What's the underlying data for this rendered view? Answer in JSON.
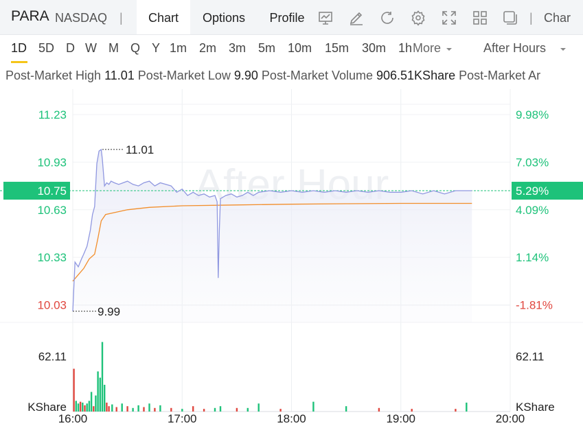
{
  "header": {
    "ticker": "PARA",
    "exchange": "NASDAQ",
    "separator": "|",
    "tabs": [
      "Chart",
      "Options",
      "Profile"
    ],
    "cut_tab": "Char",
    "icons": [
      "indicator-icon",
      "draw-icon",
      "refresh-icon",
      "settings-icon",
      "fullscreen-icon",
      "layout-icon",
      "window-icon"
    ]
  },
  "periods": {
    "items": [
      "1D",
      "5D",
      "D",
      "W",
      "M",
      "Q",
      "Y",
      "1m",
      "2m",
      "3m",
      "5m",
      "10m",
      "15m",
      "30m",
      "1h"
    ],
    "more": "More",
    "session": "After Hours"
  },
  "stats": {
    "high_label": "Post-Market High",
    "high_value": "11.01",
    "low_label": "Post-Market Low",
    "low_value": "9.90",
    "volume_label": "Post-Market Volume",
    "volume_value": "906.51KShare",
    "cut_label": "Post-Market Ar"
  },
  "chart_data": {
    "type": "line",
    "watermark": "After Hour",
    "x_ticks": [
      "16:00",
      "17:00",
      "18:00",
      "19:00",
      "20:00"
    ],
    "y_ticks": [
      "11.23",
      "10.93",
      "10.63",
      "10.33",
      "10.03"
    ],
    "y_tick_values": [
      11.23,
      10.93,
      10.63,
      10.33,
      10.03
    ],
    "y_pct_ticks": [
      "9.98%",
      "7.03%",
      "4.09%",
      "1.14%",
      "-1.81%"
    ],
    "current_price": "10.75",
    "current_pct": "5.29%",
    "current_value": 10.75,
    "max_label": "11.01",
    "max_value": 11.01,
    "max_time": 0.27,
    "min_label": "9.99",
    "min_value": 9.99,
    "min_time": 0.0,
    "ylim": [
      9.92,
      11.39
    ],
    "xlim": [
      0,
      4
    ],
    "colors": {
      "price": "#8f97e0",
      "avg": "#f28e2b",
      "up": "#1ec27a",
      "down": "#e0473f",
      "axis_green": "#1ec27a",
      "axis_red": "#e0473f"
    },
    "price": {
      "x": [
        0,
        0.02,
        0.05,
        0.08,
        0.1,
        0.13,
        0.16,
        0.18,
        0.2,
        0.22,
        0.24,
        0.26,
        0.27,
        0.29,
        0.31,
        0.33,
        0.35,
        0.38,
        0.42,
        0.46,
        0.5,
        0.55,
        0.6,
        0.65,
        0.7,
        0.75,
        0.8,
        0.85,
        0.9,
        0.95,
        1.0,
        1.05,
        1.1,
        1.15,
        1.2,
        1.25,
        1.3,
        1.32,
        1.33,
        1.34,
        1.35,
        1.4,
        1.45,
        1.5,
        1.55,
        1.6,
        1.65,
        1.7,
        1.8,
        1.9,
        2.0,
        2.1,
        2.2,
        2.3,
        2.4,
        2.5,
        2.6,
        2.7,
        2.8,
        2.9,
        3.0,
        3.1,
        3.2,
        3.3,
        3.4,
        3.5,
        3.6,
        3.65
      ],
      "values": [
        9.99,
        10.3,
        10.27,
        10.32,
        10.35,
        10.4,
        10.5,
        10.6,
        10.65,
        10.92,
        11.0,
        11.01,
        10.95,
        10.78,
        10.8,
        10.79,
        10.81,
        10.8,
        10.79,
        10.8,
        10.81,
        10.79,
        10.78,
        10.8,
        10.81,
        10.78,
        10.8,
        10.79,
        10.78,
        10.74,
        10.76,
        10.72,
        10.74,
        10.72,
        10.73,
        10.71,
        10.72,
        10.68,
        10.2,
        10.5,
        10.7,
        10.72,
        10.73,
        10.71,
        10.72,
        10.74,
        10.72,
        10.74,
        10.75,
        10.74,
        10.75,
        10.74,
        10.75,
        10.74,
        10.75,
        10.74,
        10.75,
        10.74,
        10.75,
        10.74,
        10.74,
        10.75,
        10.73,
        10.75,
        10.73,
        10.75,
        10.75,
        10.75
      ]
    },
    "average": {
      "x": [
        0,
        0.05,
        0.1,
        0.15,
        0.2,
        0.23,
        0.26,
        0.3,
        0.4,
        0.5,
        0.7,
        1.0,
        1.5,
        2.0,
        2.5,
        3.0,
        3.5,
        3.65
      ],
      "values": [
        10.18,
        10.22,
        10.26,
        10.32,
        10.35,
        10.45,
        10.56,
        10.6,
        10.615,
        10.63,
        10.645,
        10.655,
        10.66,
        10.665,
        10.668,
        10.67,
        10.67,
        10.67
      ]
    },
    "volume": {
      "axis_label": "62.11",
      "unit": "KShare",
      "ylim": [
        0,
        100
      ],
      "x": [
        0.01,
        0.03,
        0.05,
        0.07,
        0.09,
        0.11,
        0.13,
        0.15,
        0.17,
        0.19,
        0.21,
        0.23,
        0.25,
        0.27,
        0.29,
        0.31,
        0.33,
        0.36,
        0.4,
        0.45,
        0.5,
        0.55,
        0.6,
        0.65,
        0.7,
        0.75,
        0.8,
        0.9,
        1.0,
        1.1,
        1.2,
        1.3,
        1.35,
        1.5,
        1.6,
        1.7,
        1.9,
        2.2,
        2.5,
        2.8,
        3.1,
        3.5,
        3.6
      ],
      "values": [
        48,
        12,
        9,
        11,
        10,
        7,
        9,
        12,
        22,
        6,
        18,
        45,
        38,
        78,
        30,
        10,
        6,
        8,
        5,
        9,
        6,
        4,
        7,
        5,
        9,
        4,
        7,
        4,
        3,
        6,
        3,
        4,
        6,
        4,
        4,
        9,
        3,
        11,
        6,
        4,
        3,
        3,
        10
      ],
      "up": [
        false,
        true,
        true,
        false,
        true,
        false,
        true,
        true,
        true,
        false,
        true,
        true,
        true,
        true,
        true,
        false,
        false,
        true,
        false,
        true,
        false,
        true,
        true,
        false,
        true,
        false,
        true,
        false,
        true,
        false,
        false,
        true,
        true,
        false,
        true,
        true,
        false,
        true,
        true,
        false,
        false,
        false,
        true
      ]
    }
  }
}
